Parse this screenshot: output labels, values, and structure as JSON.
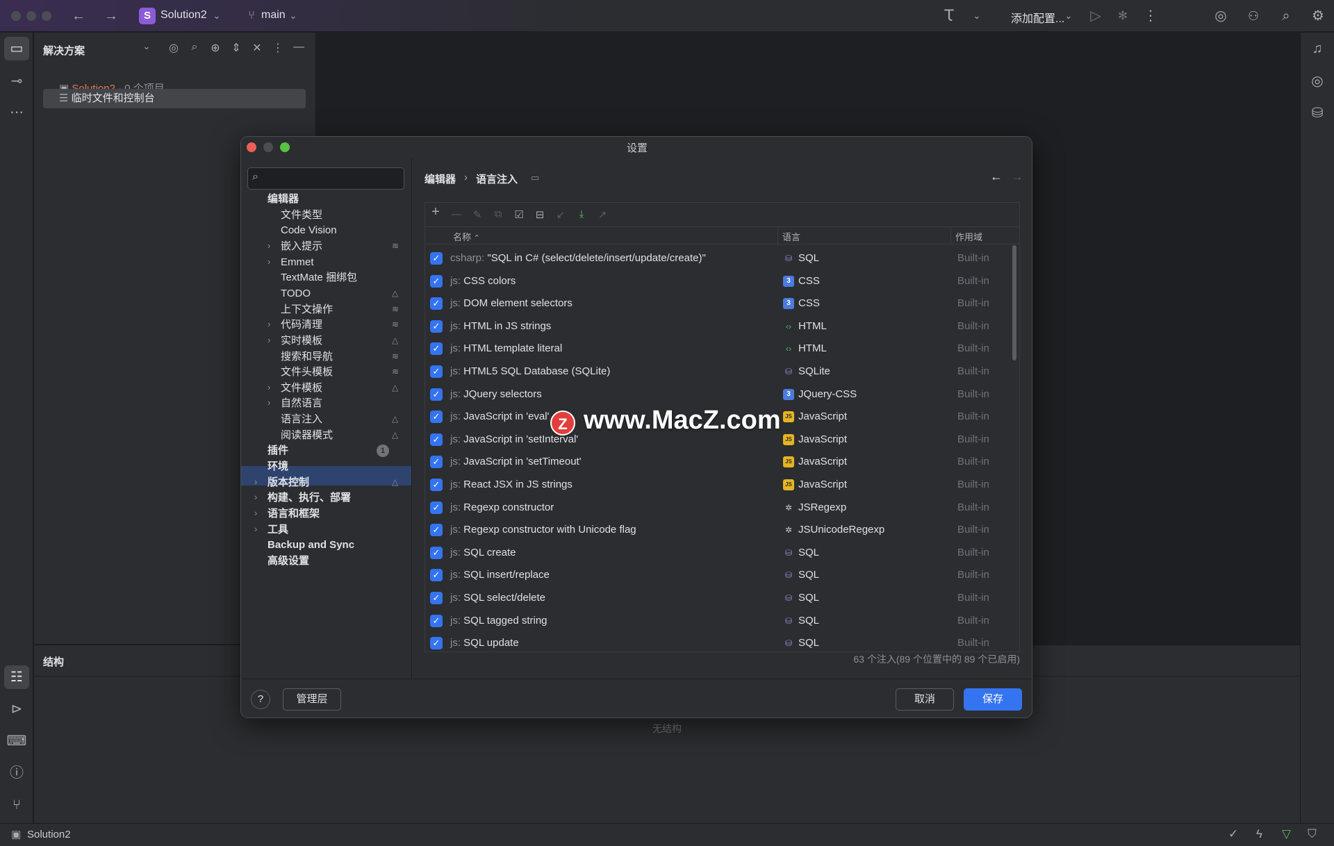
{
  "titlebar": {
    "project": "Solution2",
    "project_badge": "S",
    "branch": "main",
    "run_config": "添加配置..."
  },
  "solution_panel": {
    "title": "解决方案",
    "items": [
      {
        "label": "Solution2",
        "suffix": " · 0 个项目"
      },
      {
        "label": "临时文件和控制台"
      }
    ]
  },
  "structure_panel": {
    "title": "结构",
    "empty_text": "无结构"
  },
  "statusbar": {
    "project": "Solution2"
  },
  "dialog": {
    "title": "设置",
    "search_placeholder": "",
    "breadcrumb": [
      "编辑器",
      "语言注入"
    ],
    "nav": [
      {
        "label": "编辑器",
        "bold": true,
        "level": 0
      },
      {
        "label": "文件类型",
        "level": 1
      },
      {
        "label": "Code Vision",
        "level": 1
      },
      {
        "label": "嵌入提示",
        "level": 1,
        "arrow": true,
        "badge": "layers"
      },
      {
        "label": "Emmet",
        "level": 1,
        "arrow": true
      },
      {
        "label": "TextMate 捆绑包",
        "level": 1
      },
      {
        "label": "TODO",
        "level": 1,
        "badge": "cone"
      },
      {
        "label": "上下文操作",
        "level": 1,
        "badge": "layers"
      },
      {
        "label": "代码清理",
        "level": 1,
        "arrow": true,
        "badge": "layers"
      },
      {
        "label": "实时模板",
        "level": 1,
        "arrow": true,
        "badge": "cone"
      },
      {
        "label": "搜索和导航",
        "level": 1,
        "badge": "layers"
      },
      {
        "label": "文件头模板",
        "level": 1,
        "badge": "layers"
      },
      {
        "label": "文件模板",
        "level": 1,
        "arrow": true,
        "badge": "cone"
      },
      {
        "label": "自然语言",
        "level": 1,
        "arrow": true
      },
      {
        "label": "语言注入",
        "level": 1,
        "badge": "cone",
        "selected": true
      },
      {
        "label": "阅读器模式",
        "level": 1,
        "badge": "cone"
      },
      {
        "label": "插件",
        "bold": true,
        "level": 0,
        "count": "1"
      },
      {
        "label": "环境",
        "bold": true,
        "level": 0
      },
      {
        "label": "版本控制",
        "bold": true,
        "level": 0,
        "arrow": true,
        "badge": "cone"
      },
      {
        "label": "构建、执行、部署",
        "bold": true,
        "level": 0,
        "arrow": true
      },
      {
        "label": "语言和框架",
        "bold": true,
        "level": 0,
        "arrow": true
      },
      {
        "label": "工具",
        "bold": true,
        "level": 0,
        "arrow": true
      },
      {
        "label": "Backup and Sync",
        "bold": true,
        "level": 0
      },
      {
        "label": "高级设置",
        "bold": true,
        "level": 0
      }
    ],
    "table": {
      "headers": {
        "name": "名称",
        "language": "语言",
        "scope": "作用域"
      },
      "rows": [
        {
          "prefix": "csharp:",
          "name": "\"SQL in C# (select/delete/insert/update/create)\"",
          "lang": "SQL",
          "lang_icon": "db",
          "scope": "Built-in"
        },
        {
          "prefix": "js:",
          "name": "CSS colors",
          "lang": "CSS",
          "lang_icon": "css",
          "scope": "Built-in"
        },
        {
          "prefix": "js:",
          "name": "DOM element selectors",
          "lang": "CSS",
          "lang_icon": "css",
          "scope": "Built-in"
        },
        {
          "prefix": "js:",
          "name": "HTML in JS strings",
          "lang": "HTML",
          "lang_icon": "html",
          "scope": "Built-in"
        },
        {
          "prefix": "js:",
          "name": "HTML template literal",
          "lang": "HTML",
          "lang_icon": "html",
          "scope": "Built-in"
        },
        {
          "prefix": "js:",
          "name": "HTML5 SQL Database (SQLite)",
          "lang": "SQLite",
          "lang_icon": "db",
          "scope": "Built-in"
        },
        {
          "prefix": "js:",
          "name": "JQuery selectors",
          "lang": "JQuery-CSS",
          "lang_icon": "css",
          "scope": "Built-in"
        },
        {
          "prefix": "js:",
          "name": "JavaScript in 'eval'",
          "lang": "JavaScript",
          "lang_icon": "js",
          "scope": "Built-in"
        },
        {
          "prefix": "js:",
          "name": "JavaScript in 'setInterval'",
          "lang": "JavaScript",
          "lang_icon": "js",
          "scope": "Built-in"
        },
        {
          "prefix": "js:",
          "name": "JavaScript in 'setTimeout'",
          "lang": "JavaScript",
          "lang_icon": "js",
          "scope": "Built-in"
        },
        {
          "prefix": "js:",
          "name": "React JSX in JS strings",
          "lang": "JavaScript",
          "lang_icon": "js",
          "scope": "Built-in"
        },
        {
          "prefix": "js:",
          "name": "Regexp constructor",
          "lang": "JSRegexp",
          "lang_icon": "regex",
          "scope": "Built-in"
        },
        {
          "prefix": "js:",
          "name": "Regexp constructor with Unicode flag",
          "lang": "JSUnicodeRegexp",
          "lang_icon": "regex",
          "scope": "Built-in"
        },
        {
          "prefix": "js:",
          "name": "SQL create",
          "lang": "SQL",
          "lang_icon": "db",
          "scope": "Built-in"
        },
        {
          "prefix": "js:",
          "name": "SQL insert/replace",
          "lang": "SQL",
          "lang_icon": "db",
          "scope": "Built-in"
        },
        {
          "prefix": "js:",
          "name": "SQL select/delete",
          "lang": "SQL",
          "lang_icon": "db",
          "scope": "Built-in"
        },
        {
          "prefix": "js:",
          "name": "SQL tagged string",
          "lang": "SQL",
          "lang_icon": "db",
          "scope": "Built-in"
        },
        {
          "prefix": "js:",
          "name": "SQL update",
          "lang": "SQL",
          "lang_icon": "db",
          "scope": "Built-in"
        }
      ]
    },
    "summary": "63 个注入(89 个位置中的 89 个已启用)",
    "buttons": {
      "help": "?",
      "manage": "管理层",
      "cancel": "取消",
      "save": "保存"
    }
  },
  "watermark": {
    "logo": "Z",
    "text": "www.MacZ.com"
  },
  "colors": {
    "accent": "#3574f0",
    "selection": "#2e436e",
    "project_badge": "#8b5cd6"
  }
}
